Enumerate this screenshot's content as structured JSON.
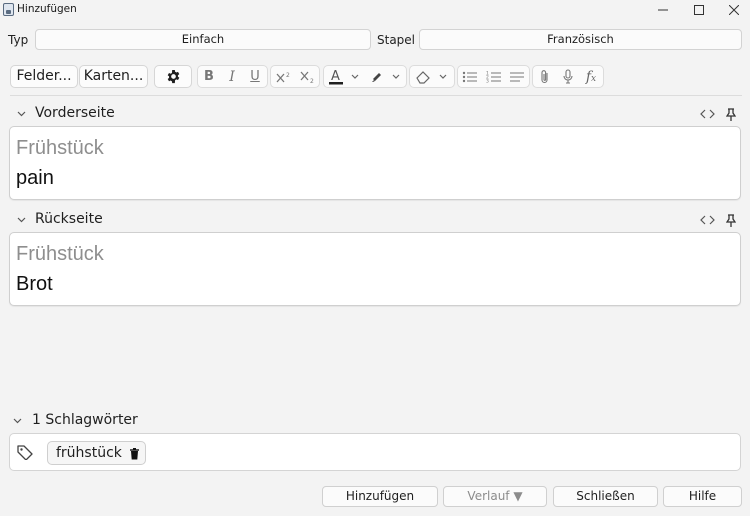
{
  "window": {
    "title": "Hinzufügen",
    "controls": [
      "minimize-icon",
      "maximize-icon",
      "close-icon"
    ]
  },
  "selectors": {
    "type_label": "Typ",
    "type_value": "Einfach",
    "deck_label": "Stapel",
    "deck_value": "Französisch"
  },
  "toolbar": {
    "fields_label": "Felder...",
    "cards_label": "Karten...",
    "options_icon": "gear-icon",
    "format_icons": [
      "bold-icon",
      "italic-icon",
      "underline-icon",
      "superscript-icon",
      "subscript-icon",
      "text-color-icon",
      "highlight-icon",
      "eraser-icon",
      "bullet-list-icon",
      "numbered-list-icon",
      "align-icon",
      "attachment-icon",
      "microphone-icon",
      "formula-icon"
    ],
    "text_color": "#1f1f1f"
  },
  "fields": [
    {
      "name": "Vorderseite",
      "hint": "Frühstück",
      "content": "pain"
    },
    {
      "name": "Rückseite",
      "hint": "Frühstück",
      "content": "Brot"
    }
  ],
  "tags": {
    "header": "1 Schlagwörter",
    "items": [
      "frühstück"
    ]
  },
  "buttons": {
    "add": "Hinzufügen",
    "history": "Verlauf ▼",
    "close": "Schließen",
    "help": "Hilfe"
  }
}
